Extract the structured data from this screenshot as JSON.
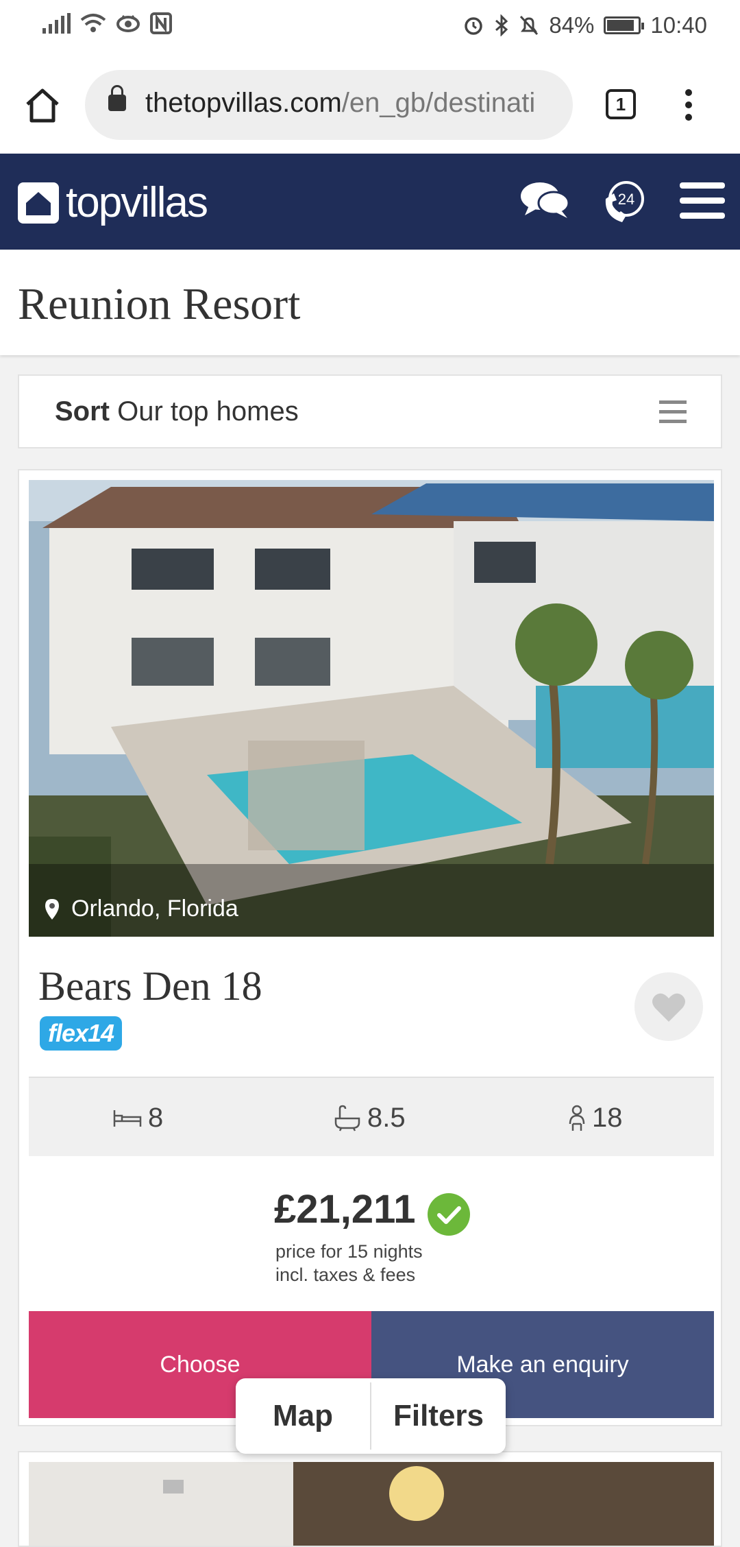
{
  "status_bar": {
    "battery": "84%",
    "time": "10:40"
  },
  "browser": {
    "url_host": "thetopvillas.com",
    "url_path": "/en_gb/destinati",
    "tab_count": "1"
  },
  "header": {
    "logo_text": "topvillas",
    "phone_badge": "24"
  },
  "page_title": "Reunion Resort",
  "sort": {
    "label": "Sort",
    "value": "Our top homes"
  },
  "listing": {
    "location": "Orlando, Florida",
    "name": "Bears Den 18",
    "badge": "flex14",
    "bedrooms": "8",
    "bathrooms": "8.5",
    "guests": "18",
    "price": "£21,211",
    "price_line1": "price for 15 nights",
    "price_line2": "incl. taxes & fees",
    "choose_label": "Choose",
    "enquiry_label": "Make an enquiry"
  },
  "floating_bar": {
    "map_label": "Map",
    "filters_label": "Filters"
  },
  "colors": {
    "header": "#1f2d58",
    "choose": "#d63b6d",
    "enquiry": "#455380",
    "badge": "#2ea8e6",
    "check": "#6cb83a"
  }
}
